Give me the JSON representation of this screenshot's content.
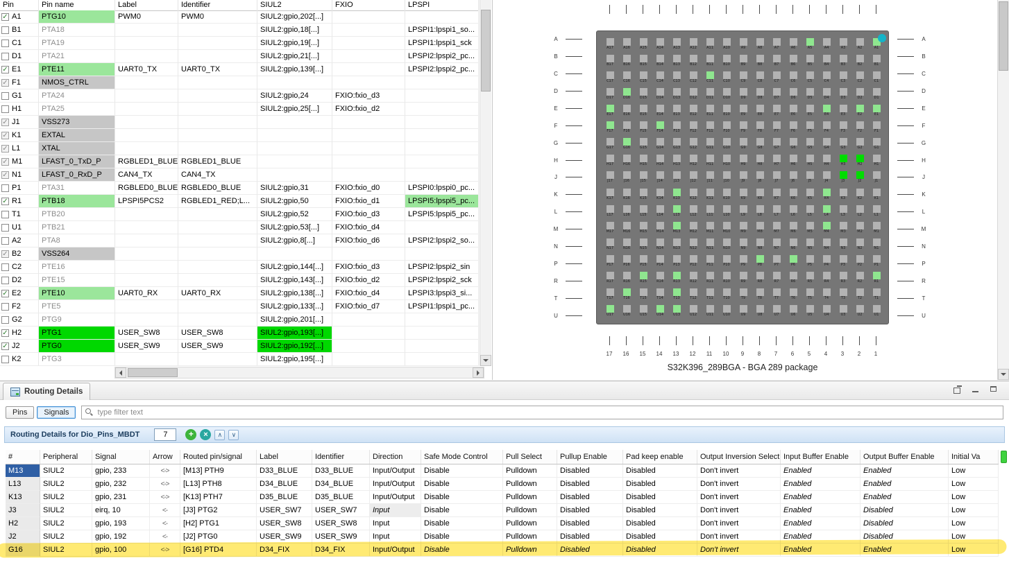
{
  "colors": {
    "light_green": "#9be69b",
    "bright_green": "#00d800",
    "system_gray": "#c6c6c6",
    "selection_blue": "#2f5fa5",
    "highlighter_yellow": "#ffd800",
    "bga_body": "#767676",
    "bga_pin_gray": "#b3b3b3",
    "bga_pin_light_green": "#8fe68f",
    "bga_pin_bright_green": "#00dc00",
    "pin1_marker_teal": "#14b4c8"
  },
  "icons": {
    "checkmark": "✓",
    "add": "+",
    "delete": "×",
    "move_up": "∧",
    "move_down": "∨"
  },
  "pin_table": {
    "headers": [
      "Pin",
      "Pin name",
      "Label",
      "Identifier",
      "SIUL2",
      "FXIO",
      "LPSPI"
    ],
    "rows": [
      {
        "pin": "A1",
        "checked": true,
        "dim": false,
        "name": "PTG10",
        "name_bg": "green",
        "label": "PWM0",
        "identifier": "PWM0",
        "siul2": "SIUL2:gpio,202[...]",
        "siul2_bg": "",
        "fxio": "",
        "lpspi": "",
        "lpspi_bg": ""
      },
      {
        "pin": "B1",
        "checked": false,
        "dim": false,
        "name": "PTA18",
        "name_bg": "",
        "label": "",
        "identifier": "",
        "siul2": "SIUL2:gpio,18[...]",
        "siul2_bg": "",
        "fxio": "",
        "lpspi": "LPSPI1:lpspi1_so...",
        "lpspi_bg": ""
      },
      {
        "pin": "C1",
        "checked": false,
        "dim": false,
        "name": "PTA19",
        "name_bg": "",
        "label": "",
        "identifier": "",
        "siul2": "SIUL2:gpio,19[...]",
        "siul2_bg": "",
        "fxio": "",
        "lpspi": "LPSPI1:lpspi1_sck",
        "lpspi_bg": ""
      },
      {
        "pin": "D1",
        "checked": false,
        "dim": false,
        "name": "PTA21",
        "name_bg": "",
        "label": "",
        "identifier": "",
        "siul2": "SIUL2:gpio,21[...]",
        "siul2_bg": "",
        "fxio": "",
        "lpspi": "LPSPI2:lpspi2_pc...",
        "lpspi_bg": ""
      },
      {
        "pin": "E1",
        "checked": true,
        "dim": false,
        "name": "PTE11",
        "name_bg": "green",
        "label": "UART0_TX",
        "identifier": "UART0_TX",
        "siul2": "SIUL2:gpio,139[...]",
        "siul2_bg": "",
        "fxio": "",
        "lpspi": "LPSPI2:lpspi2_pc...",
        "lpspi_bg": ""
      },
      {
        "pin": "F1",
        "checked": true,
        "dim": true,
        "name": "NMOS_CTRL",
        "name_bg": "gray",
        "label": "",
        "identifier": "",
        "siul2": "",
        "siul2_bg": "",
        "fxio": "",
        "lpspi": "",
        "lpspi_bg": ""
      },
      {
        "pin": "G1",
        "checked": false,
        "dim": false,
        "name": "PTA24",
        "name_bg": "",
        "label": "",
        "identifier": "",
        "siul2": "SIUL2:gpio,24",
        "siul2_bg": "",
        "fxio": "FXIO:fxio_d3",
        "lpspi": "",
        "lpspi_bg": ""
      },
      {
        "pin": "H1",
        "checked": false,
        "dim": false,
        "name": "PTA25",
        "name_bg": "",
        "label": "",
        "identifier": "",
        "siul2": "SIUL2:gpio,25[...]",
        "siul2_bg": "",
        "fxio": "FXIO:fxio_d2",
        "lpspi": "",
        "lpspi_bg": ""
      },
      {
        "pin": "J1",
        "checked": true,
        "dim": true,
        "name": "VSS273",
        "name_bg": "gray",
        "label": "",
        "identifier": "",
        "siul2": "",
        "siul2_bg": "",
        "fxio": "",
        "lpspi": "",
        "lpspi_bg": ""
      },
      {
        "pin": "K1",
        "checked": true,
        "dim": true,
        "name": "EXTAL",
        "name_bg": "gray",
        "label": "",
        "identifier": "",
        "siul2": "",
        "siul2_bg": "",
        "fxio": "",
        "lpspi": "",
        "lpspi_bg": ""
      },
      {
        "pin": "L1",
        "checked": true,
        "dim": true,
        "name": "XTAL",
        "name_bg": "gray",
        "label": "",
        "identifier": "",
        "siul2": "",
        "siul2_bg": "",
        "fxio": "",
        "lpspi": "",
        "lpspi_bg": ""
      },
      {
        "pin": "M1",
        "checked": true,
        "dim": true,
        "name": "LFAST_0_TxD_P",
        "name_bg": "gray",
        "label": "RGBLED1_BLUE",
        "identifier": "RGBLED1_BLUE",
        "siul2": "",
        "siul2_bg": "",
        "fxio": "",
        "lpspi": "",
        "lpspi_bg": ""
      },
      {
        "pin": "N1",
        "checked": true,
        "dim": true,
        "name": "LFAST_0_RxD_P",
        "name_bg": "gray",
        "label": "CAN4_TX",
        "identifier": "CAN4_TX",
        "siul2": "",
        "siul2_bg": "",
        "fxio": "",
        "lpspi": "",
        "lpspi_bg": ""
      },
      {
        "pin": "P1",
        "checked": false,
        "dim": false,
        "name": "PTA31",
        "name_bg": "",
        "label": "RGBLED0_BLUE",
        "identifier": "RGBLED0_BLUE",
        "siul2": "SIUL2:gpio,31",
        "siul2_bg": "",
        "fxio": "FXIO:fxio_d0",
        "lpspi": "LPSPI0:lpspi0_pc...",
        "lpspi_bg": ""
      },
      {
        "pin": "R1",
        "checked": true,
        "dim": false,
        "name": "PTB18",
        "name_bg": "green",
        "label": "LPSPI5PCS2",
        "identifier": "RGBLED1_RED;L...",
        "siul2": "SIUL2:gpio,50",
        "siul2_bg": "",
        "fxio": "FXIO:fxio_d1",
        "lpspi": "LPSPI5:lpspi5_pc...",
        "lpspi_bg": "green"
      },
      {
        "pin": "T1",
        "checked": false,
        "dim": false,
        "name": "PTB20",
        "name_bg": "",
        "label": "",
        "identifier": "",
        "siul2": "SIUL2:gpio,52",
        "siul2_bg": "",
        "fxio": "FXIO:fxio_d3",
        "lpspi": "LPSPI5:lpspi5_pc...",
        "lpspi_bg": ""
      },
      {
        "pin": "U1",
        "checked": false,
        "dim": false,
        "name": "PTB21",
        "name_bg": "",
        "label": "",
        "identifier": "",
        "siul2": "SIUL2:gpio,53[...]",
        "siul2_bg": "",
        "fxio": "FXIO:fxio_d4",
        "lpspi": "",
        "lpspi_bg": ""
      },
      {
        "pin": "A2",
        "checked": false,
        "dim": false,
        "name": "PTA8",
        "name_bg": "",
        "label": "",
        "identifier": "",
        "siul2": "SIUL2:gpio,8[...]",
        "siul2_bg": "",
        "fxio": "FXIO:fxio_d6",
        "lpspi": "LPSPI2:lpspi2_so...",
        "lpspi_bg": ""
      },
      {
        "pin": "B2",
        "checked": true,
        "dim": true,
        "name": "VSS264",
        "name_bg": "gray",
        "label": "",
        "identifier": "",
        "siul2": "",
        "siul2_bg": "",
        "fxio": "",
        "lpspi": "",
        "lpspi_bg": ""
      },
      {
        "pin": "C2",
        "checked": false,
        "dim": false,
        "name": "PTE16",
        "name_bg": "",
        "label": "",
        "identifier": "",
        "siul2": "SIUL2:gpio,144[...]",
        "siul2_bg": "",
        "fxio": "FXIO:fxio_d3",
        "lpspi": "LPSPI2:lpspi2_sin",
        "lpspi_bg": ""
      },
      {
        "pin": "D2",
        "checked": false,
        "dim": false,
        "name": "PTE15",
        "name_bg": "",
        "label": "",
        "identifier": "",
        "siul2": "SIUL2:gpio,143[...]",
        "siul2_bg": "",
        "fxio": "FXIO:fxio_d2",
        "lpspi": "LPSPI2:lpspi2_sck",
        "lpspi_bg": ""
      },
      {
        "pin": "E2",
        "checked": true,
        "dim": false,
        "name": "PTE10",
        "name_bg": "green",
        "label": "UART0_RX",
        "identifier": "UART0_RX",
        "siul2": "SIUL2:gpio,138[...]",
        "siul2_bg": "",
        "fxio": "FXIO:fxio_d4",
        "lpspi": "LPSPI3:lpspi3_si...",
        "lpspi_bg": ""
      },
      {
        "pin": "F2",
        "checked": false,
        "dim": false,
        "name": "PTE5",
        "name_bg": "",
        "label": "",
        "identifier": "",
        "siul2": "SIUL2:gpio,133[...]",
        "siul2_bg": "",
        "fxio": "FXIO:fxio_d7",
        "lpspi": "LPSPI1:lpspi1_pc...",
        "lpspi_bg": ""
      },
      {
        "pin": "G2",
        "checked": false,
        "dim": false,
        "name": "PTG9",
        "name_bg": "",
        "label": "",
        "identifier": "",
        "siul2": "SIUL2:gpio,201[...]",
        "siul2_bg": "",
        "fxio": "",
        "lpspi": "",
        "lpspi_bg": ""
      },
      {
        "pin": "H2",
        "checked": true,
        "dim": false,
        "name": "PTG1",
        "name_bg": "bright",
        "label": "USER_SW8",
        "identifier": "USER_SW8",
        "siul2": "SIUL2:gpio,193[...]",
        "siul2_bg": "bright",
        "fxio": "",
        "lpspi": "",
        "lpspi_bg": ""
      },
      {
        "pin": "J2",
        "checked": true,
        "dim": false,
        "name": "PTG0",
        "name_bg": "bright",
        "label": "USER_SW9",
        "identifier": "USER_SW9",
        "siul2": "SIUL2:gpio,192[...]",
        "siul2_bg": "bright",
        "fxio": "",
        "lpspi": "",
        "lpspi_bg": ""
      },
      {
        "pin": "K2",
        "checked": false,
        "dim": false,
        "name": "PTG3",
        "name_bg": "",
        "label": "",
        "identifier": "",
        "siul2": "SIUL2:gpio,195[...]",
        "siul2_bg": "",
        "fxio": "",
        "lpspi": "",
        "lpspi_bg": ""
      }
    ]
  },
  "bga": {
    "caption": "S32K396_289BGA - BGA 289 package",
    "row_letters": [
      "A",
      "B",
      "C",
      "D",
      "E",
      "F",
      "G",
      "H",
      "J",
      "K",
      "L",
      "M",
      "N",
      "P",
      "R",
      "T",
      "U"
    ],
    "col_numbers": [
      "17",
      "16",
      "15",
      "14",
      "13",
      "12",
      "11",
      "10",
      "9",
      "8",
      "7",
      "6",
      "5",
      "4",
      "3",
      "2",
      "1"
    ],
    "light_green_pins": [
      "A5",
      "A1",
      "C11",
      "D16",
      "E17",
      "E4",
      "E2",
      "E1",
      "F17",
      "F14",
      "G16",
      "K13",
      "K4",
      "L13",
      "L4",
      "M13",
      "M4",
      "P8",
      "P6",
      "R15",
      "R13",
      "R1",
      "T16",
      "T13",
      "U17",
      "U14",
      "U13"
    ],
    "bright_green_pins": [
      "H3",
      "H2",
      "J3",
      "J2"
    ]
  },
  "routing": {
    "title": "Routing Details",
    "tabs": [
      "Pins",
      "Signals"
    ],
    "active_tab": "Signals",
    "filter_placeholder": "type filter text",
    "toolbar_label": "Routing Details for Dio_Pins_MBDT",
    "count": "7",
    "window_icons": [
      "restore-icon",
      "minimize-icon",
      "maximize-icon"
    ],
    "headers": [
      "#",
      "Peripheral",
      "Signal",
      "Arrow",
      "Routed pin/signal",
      "Label",
      "Identifier",
      "Direction",
      "Safe Mode Control",
      "Pull Select",
      "Pullup Enable",
      "Pad keep enable",
      "Output Inversion Select",
      "Input Buffer Enable",
      "Output Buffer Enable",
      "Initial Va"
    ],
    "rows": [
      {
        "cells": [
          "M13",
          "SIUL2",
          "gpio, 233",
          "<->",
          "[M13] PTH9",
          "D33_BLUE",
          "D33_BLUE",
          "Input/Output",
          "Disable",
          "Pulldown",
          "Disabled",
          "Disabled",
          "Don't invert",
          "Enabled",
          "Enabled",
          "Low"
        ],
        "italic": [
          13,
          14
        ],
        "selected": true
      },
      {
        "cells": [
          "L13",
          "SIUL2",
          "gpio, 232",
          "<->",
          "[L13] PTH8",
          "D34_BLUE",
          "D34_BLUE",
          "Input/Output",
          "Disable",
          "Pulldown",
          "Disabled",
          "Disabled",
          "Don't invert",
          "Enabled",
          "Enabled",
          "Low"
        ],
        "italic": [
          13,
          14
        ]
      },
      {
        "cells": [
          "K13",
          "SIUL2",
          "gpio, 231",
          "<->",
          "[K13] PTH7",
          "D35_BLUE",
          "D35_BLUE",
          "Input/Output",
          "Disable",
          "Pulldown",
          "Disabled",
          "Disabled",
          "Don't invert",
          "Enabled",
          "Enabled",
          "Low"
        ],
        "italic": [
          13,
          14
        ]
      },
      {
        "cells": [
          "J3",
          "SIUL2",
          "eirq, 10",
          "<-",
          "[J3] PTG2",
          "USER_SW7",
          "USER_SW7",
          "Input",
          "Disable",
          "Pulldown",
          "Disabled",
          "Disabled",
          "Don't invert",
          "Enabled",
          "Disabled",
          "Low"
        ],
        "italic": [
          7,
          13,
          14
        ],
        "shaded": [
          7
        ]
      },
      {
        "cells": [
          "H2",
          "SIUL2",
          "gpio, 193",
          "<-",
          "[H2] PTG1",
          "USER_SW8",
          "USER_SW8",
          "Input",
          "Disable",
          "Pulldown",
          "Disabled",
          "Disabled",
          "Don't invert",
          "Enabled",
          "Disabled",
          "Low"
        ],
        "italic": [
          13,
          14
        ]
      },
      {
        "cells": [
          "J2",
          "SIUL2",
          "gpio, 192",
          "<-",
          "[J2] PTG0",
          "USER_SW9",
          "USER_SW9",
          "Input",
          "Disable",
          "Pulldown",
          "Disabled",
          "Disabled",
          "Don't invert",
          "Enabled",
          "Disabled",
          "Low"
        ],
        "italic": [
          13,
          14
        ]
      },
      {
        "cells": [
          "G16",
          "SIUL2",
          "gpio, 100",
          "<->",
          "[G16] PTD4",
          "D34_FIX",
          "D34_FIX",
          "Input/Output",
          "Disable",
          "Pulldown",
          "Disabled",
          "Disabled",
          "Don't invert",
          "Enabled",
          "Enabled",
          "Low"
        ],
        "italic": [
          8,
          9,
          10,
          11,
          12,
          13,
          14
        ],
        "highlighted": true
      }
    ]
  }
}
